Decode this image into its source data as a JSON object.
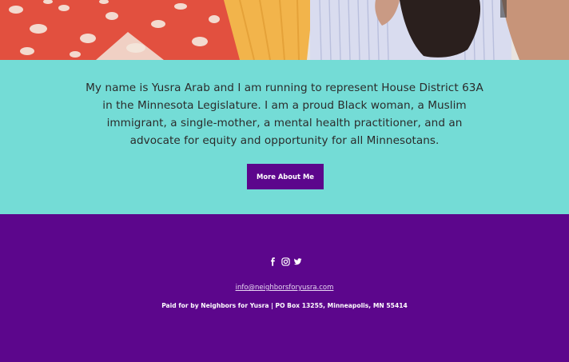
{
  "hero": {
    "image_description": "photo-strip"
  },
  "intro": {
    "paragraph": "My name is Yusra Arab and I am running to represent House District 63A in the Minnesota Legislature. I am a proud Black woman, a Muslim immigrant, a single-mother, a mental health practitioner, and an advocate for equity and opportunity for all Minnesotans.",
    "button_label": "More About Me",
    "background_color": "#74dcd6",
    "button_color": "#5c068c"
  },
  "footer": {
    "background_color": "#5c068c",
    "social_icons": [
      "facebook-icon",
      "instagram-icon",
      "twitter-icon"
    ],
    "email": "info@neighborsforyusra.com",
    "disclaimer": "Paid for by Neighbors for Yusra | PO Box 13255, Minneapolis, MN 55414"
  }
}
